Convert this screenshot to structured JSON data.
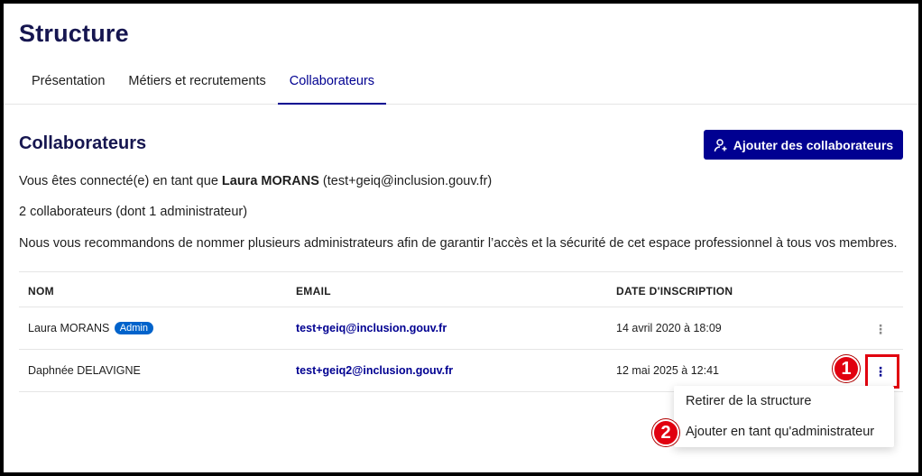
{
  "page": {
    "title": "Structure"
  },
  "tabs": [
    {
      "label": "Présentation"
    },
    {
      "label": "Métiers et recrutements"
    },
    {
      "label": "Collaborateurs"
    }
  ],
  "section": {
    "title": "Collaborateurs",
    "add_button_label": "Ajouter des collaborateurs",
    "connected_prefix": "Vous êtes connecté(e) en tant que ",
    "connected_name": "Laura MORANS",
    "connected_email": " (test+geiq@inclusion.gouv.fr)",
    "count_text": "2 collaborateurs (dont 1 administrateur)",
    "recommendation": "Nous vous recommandons de nommer plusieurs administrateurs afin de garantir l’accès et la sécurité de cet espace professionnel à tous vos membres."
  },
  "table": {
    "headers": {
      "name": "NOM",
      "email": "EMAIL",
      "date": "DATE D'INSCRIPTION"
    },
    "rows": [
      {
        "name": "Laura MORANS",
        "badge": "Admin",
        "email": "test+geiq@inclusion.gouv.fr",
        "date": "14 avril 2020 à 18:09"
      },
      {
        "name": "Daphnée DELAVIGNE",
        "email": "test+geiq2@inclusion.gouv.fr",
        "date": "12 mai 2025 à 12:41"
      }
    ]
  },
  "menu": {
    "items": [
      {
        "label": "Retirer de la structure"
      },
      {
        "label": "Ajouter en tant qu'administrateur"
      }
    ]
  },
  "annotations": {
    "step1": "1",
    "step2": "2",
    "highlight_color": "#e1000f"
  },
  "colors": {
    "primary": "#000091",
    "title": "#161650",
    "badge": "#0063cb"
  },
  "icons": {
    "add_button": "user-add-icon",
    "row_actions": "kebab-menu-icon"
  }
}
